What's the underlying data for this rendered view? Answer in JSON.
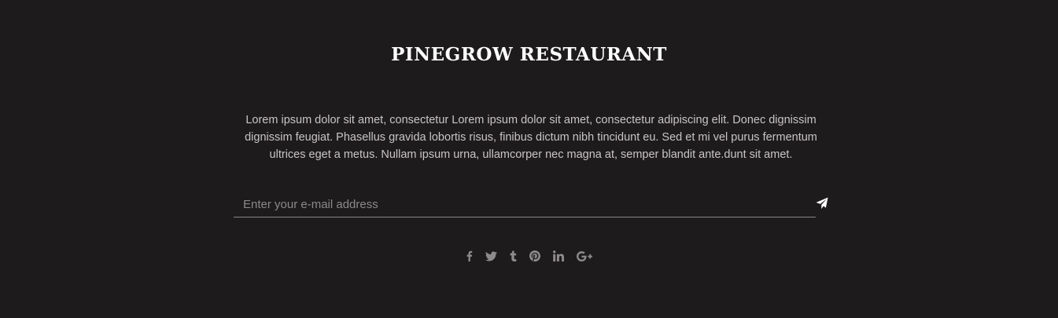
{
  "footer": {
    "brand": "PINEGROW RESTAURANT",
    "description": "Lorem ipsum dolor sit amet, consectetur Lorem ipsum dolor sit amet, consectetur adipiscing elit. Donec dignissim dignissim feugiat. Phasellus gravida lobortis risus, finibus dictum nibh tincidunt eu. Sed et mi vel purus fermentum ultrices eget a metus. Nullam ipsum urna, ullamcorper nec magna at, semper blandit ante.dunt sit amet.",
    "subscribe": {
      "placeholder": "Enter your e-mail address",
      "value": "",
      "send_icon": "paper-plane-icon"
    },
    "social": [
      {
        "icon": "facebook-icon"
      },
      {
        "icon": "twitter-icon"
      },
      {
        "icon": "tumblr-icon"
      },
      {
        "icon": "pinterest-icon"
      },
      {
        "icon": "linkedin-icon"
      },
      {
        "icon": "google-plus-icon"
      }
    ]
  },
  "colors": {
    "background": "#1d1b1c",
    "brand_text": "#ffffff",
    "body_text": "#c9c5c6",
    "muted": "#8e8b8d"
  }
}
